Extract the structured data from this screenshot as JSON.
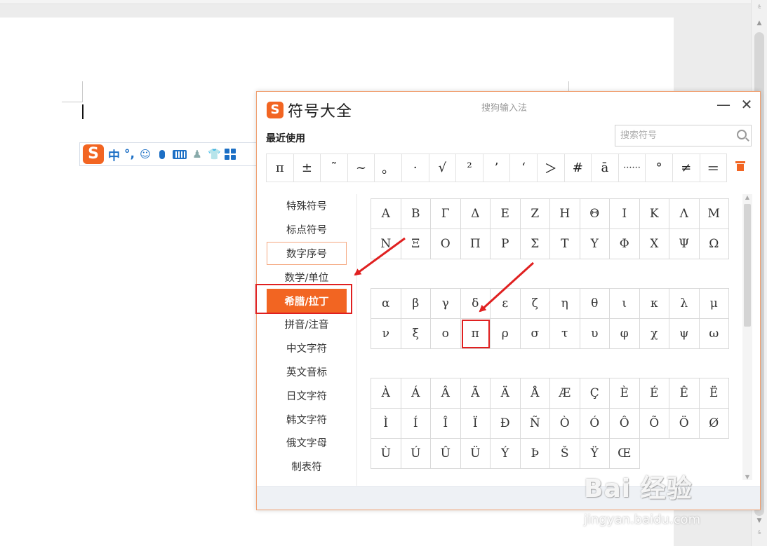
{
  "ime_toolbar": {
    "mode_label": "中",
    "punct_label": "°,"
  },
  "dialog": {
    "title": "符号大全",
    "subtitle": "搜狗输入法",
    "minimize": "—",
    "close": "✕",
    "recent_label": "最近使用",
    "search_placeholder": "搜索符号",
    "recent_symbols": [
      "π",
      "±",
      "˜",
      "~",
      "。",
      "·",
      "√",
      "²",
      "’",
      "‘",
      "＞",
      "#",
      "ā",
      "······",
      "°",
      "≠",
      "＝"
    ],
    "categories": [
      {
        "label": "特殊符号"
      },
      {
        "label": "标点符号"
      },
      {
        "label": "数字序号"
      },
      {
        "label": "数学/单位"
      },
      {
        "label": "希腊/拉丁"
      },
      {
        "label": "拼音/注音"
      },
      {
        "label": "中文字符"
      },
      {
        "label": "英文音标"
      },
      {
        "label": "日文字符"
      },
      {
        "label": "韩文字符"
      },
      {
        "label": "俄文字母"
      },
      {
        "label": "制表符"
      }
    ],
    "outlined_category": "数字序号",
    "active_category": "希腊/拉丁",
    "greek_upper": [
      "Α",
      "Β",
      "Γ",
      "Δ",
      "Ε",
      "Ζ",
      "Η",
      "Θ",
      "Ι",
      "Κ",
      "Λ",
      "Μ",
      "Ν",
      "Ξ",
      "Ο",
      "Π",
      "Ρ",
      "Σ",
      "Τ",
      "Υ",
      "Φ",
      "Χ",
      "Ψ",
      "Ω"
    ],
    "greek_lower": [
      "α",
      "β",
      "γ",
      "δ",
      "ε",
      "ζ",
      "η",
      "θ",
      "ι",
      "κ",
      "λ",
      "μ",
      "ν",
      "ξ",
      "ο",
      "π",
      "ρ",
      "σ",
      "τ",
      "υ",
      "φ",
      "χ",
      "ψ",
      "ω"
    ],
    "latin": [
      "À",
      "Á",
      "Â",
      "Ã",
      "Ä",
      "Å",
      "Æ",
      "Ç",
      "È",
      "É",
      "Ê",
      "Ë",
      "Ì",
      "Í",
      "Î",
      "Ï",
      "Ð",
      "Ñ",
      "Ò",
      "Ó",
      "Ô",
      "Õ",
      "Ö",
      "Ø",
      "Ù",
      "Ú",
      "Û",
      "Ü",
      "Ý",
      "Þ",
      "Š",
      "Ÿ",
      "Œ"
    ],
    "highlighted_symbol": "π"
  },
  "watermark": {
    "line1": "Bai 经验",
    "line2": "jingyan.baidu.com"
  },
  "colors": {
    "accent": "#f26522",
    "annotation_red": "#e02020",
    "ime_blue": "#1c6fc5"
  }
}
